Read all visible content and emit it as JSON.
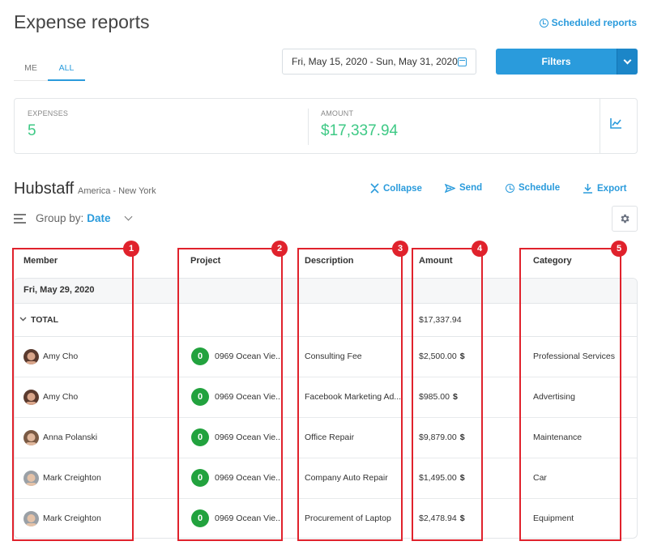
{
  "header": {
    "title": "Expense reports",
    "scheduled_reports_label": "Scheduled reports"
  },
  "tabs": [
    {
      "label": "ME",
      "active": false
    },
    {
      "label": "ALL",
      "active": true
    }
  ],
  "date_range": "Fri, May 15, 2020 - Sun, May 31, 2020",
  "filters_label": "Filters",
  "summary": {
    "expenses_label": "EXPENSES",
    "expenses_value": "5",
    "amount_label": "AMOUNT",
    "amount_value": "$17,337.94"
  },
  "org": {
    "name": "Hubstaff",
    "timezone": "America - New York"
  },
  "actions": {
    "collapse": "Collapse",
    "send": "Send",
    "schedule": "Schedule",
    "export": "Export"
  },
  "group_by": {
    "label": "Group by:",
    "value": "Date"
  },
  "table": {
    "columns": [
      "Member",
      "Project",
      "Description",
      "Amount",
      "Category"
    ],
    "group_date": "Fri, May 29, 2020",
    "total_label": "TOTAL",
    "total_amount": "$17,337.94",
    "currency_symbol": "$",
    "rows": [
      {
        "member": "Amy Cho",
        "badge": "0",
        "project": "0969 Ocean Vie...",
        "description": "Consulting Fee",
        "amount": "$2,500.00",
        "category": "Professional Services"
      },
      {
        "member": "Amy Cho",
        "badge": "0",
        "project": "0969 Ocean Vie...",
        "description": "Facebook Marketing Ad...",
        "amount": "$985.00",
        "category": "Advertising"
      },
      {
        "member": "Anna Polanski",
        "badge": "0",
        "project": "0969 Ocean Vie...",
        "description": "Office Repair",
        "amount": "$9,879.00",
        "category": "Maintenance"
      },
      {
        "member": "Mark Creighton",
        "badge": "0",
        "project": "0969 Ocean Vie...",
        "description": "Company Auto Repair",
        "amount": "$1,495.00",
        "category": "Car"
      },
      {
        "member": "Mark Creighton",
        "badge": "0",
        "project": "0969 Ocean Vie...",
        "description": "Procurement of Laptop",
        "amount": "$2,478.94",
        "category": "Equipment"
      }
    ]
  },
  "annotations": [
    "1",
    "2",
    "3",
    "4",
    "5"
  ],
  "colors": {
    "accent": "#2a9bdc",
    "positive": "#3ec985",
    "badge": "#22a23e",
    "annotation": "#e0222c"
  }
}
